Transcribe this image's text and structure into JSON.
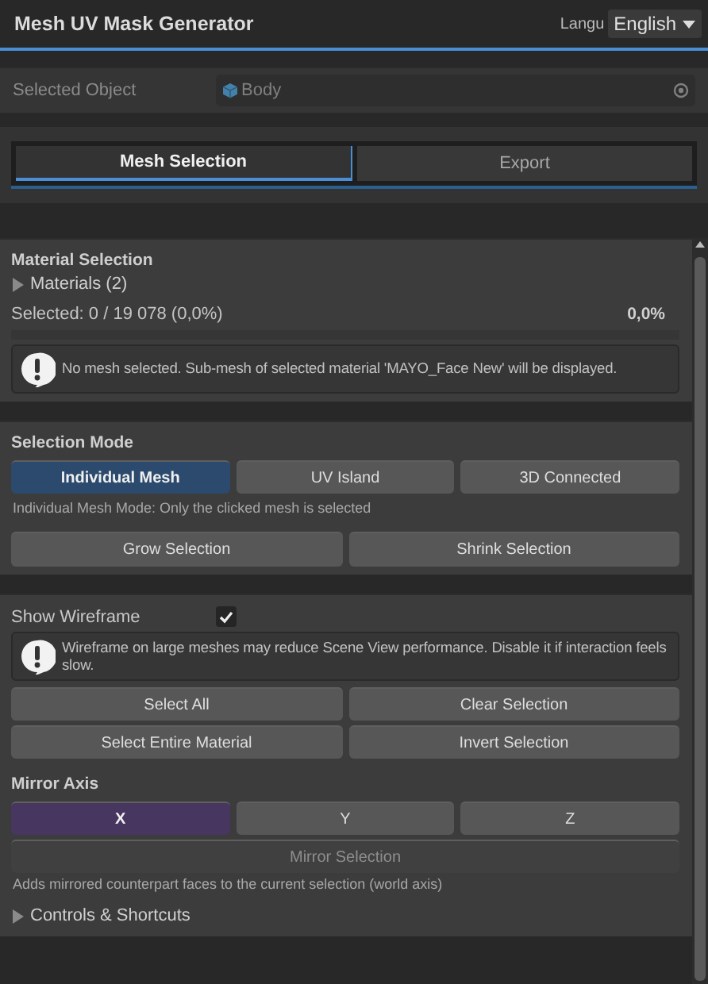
{
  "window": {
    "title": "Mesh UV Mask Generator"
  },
  "language": {
    "label": "Langu",
    "value": "English"
  },
  "selected_object": {
    "label": "Selected Object",
    "value": "Body",
    "disabled": true
  },
  "tabs": [
    {
      "label": "Mesh Selection",
      "selected": true
    },
    {
      "label": "Export",
      "selected": false
    }
  ],
  "material_selection": {
    "title": "Material Selection",
    "materials": {
      "label": "Materials (2)",
      "expanded": false
    },
    "selected_count": "Selected: 0 / 19 078 (0,0%)",
    "percent": "0,0%",
    "level": 0,
    "message": "No mesh selected. Sub-mesh of selected material 'MAYO_Face New' will be displayed."
  },
  "selection_mode": {
    "title": "Selection Mode",
    "modes": [
      {
        "label": "Individual Mesh",
        "selected": true
      },
      {
        "label": "UV Island",
        "selected": false
      },
      {
        "label": "3D Connected",
        "selected": false
      }
    ],
    "description": "Individual Mesh Mode: Only the clicked mesh is selected",
    "buttons": [
      "Grow Selection",
      "Shrink Selection"
    ]
  },
  "wireframe": {
    "label": "Show Wireframe",
    "checked": true,
    "warning": "Wireframe on large meshes may reduce Scene View performance. Disable it if interaction feels slow."
  },
  "action_rows": [
    {
      "buttons": [
        "Select All",
        "Clear Selection"
      ]
    },
    {
      "buttons": [
        "Select Entire Material",
        "Invert Selection"
      ]
    }
  ],
  "mirror": {
    "title": "Mirror Axis",
    "axes": [
      {
        "label": "X",
        "selected": true
      },
      {
        "label": "Y",
        "selected": false
      },
      {
        "label": "Z",
        "selected": false
      }
    ],
    "button": {
      "label": "Mirror Selection",
      "disabled": true
    },
    "description": "Adds mirrored counterpart faces to the current selection (world axis)"
  },
  "controls": {
    "label": "Controls & Shortcuts",
    "expanded": false
  }
}
